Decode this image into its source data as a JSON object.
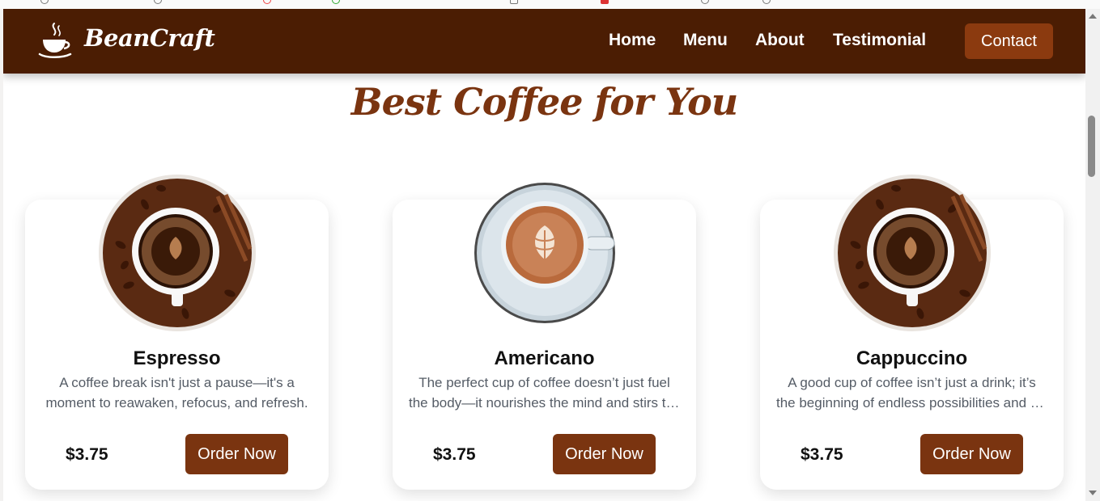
{
  "brand": {
    "name": "BeanCraft",
    "logo_icon": "coffee-cup-icon"
  },
  "nav": {
    "links": [
      "Home",
      "Menu",
      "About",
      "Testimonial"
    ],
    "contact_label": "Contact"
  },
  "section": {
    "title": "Best Coffee for You"
  },
  "products": [
    {
      "name": "Espresso",
      "desc_line1": "A coffee break isn't just a pause—it's a",
      "desc_line2": "moment to reawaken, refocus, and refresh.",
      "price": "$3.75",
      "cta": "Order Now",
      "image_icon": "coffee-beans-cup-icon"
    },
    {
      "name": "Americano",
      "desc_line1": "The perfect cup of coffee doesn’t just fuel",
      "desc_line2": "the body—it nourishes the mind and stirs the soul.",
      "price": "$3.75",
      "cta": "Order Now",
      "image_icon": "latte-art-cup-icon"
    },
    {
      "name": "Cappuccino",
      "desc_line1": "A good cup of coffee isn’t just a drink; it’s",
      "desc_line2": "the beginning of endless possibilities and new ideas.",
      "price": "$3.75",
      "cta": "Order Now",
      "image_icon": "coffee-beans-cup-icon"
    }
  ],
  "colors": {
    "navbar": "#4b1d03",
    "accent": "#7a3410",
    "contact_button": "#8b3a0f",
    "text_dark": "#111111",
    "text_muted": "#555c66"
  }
}
